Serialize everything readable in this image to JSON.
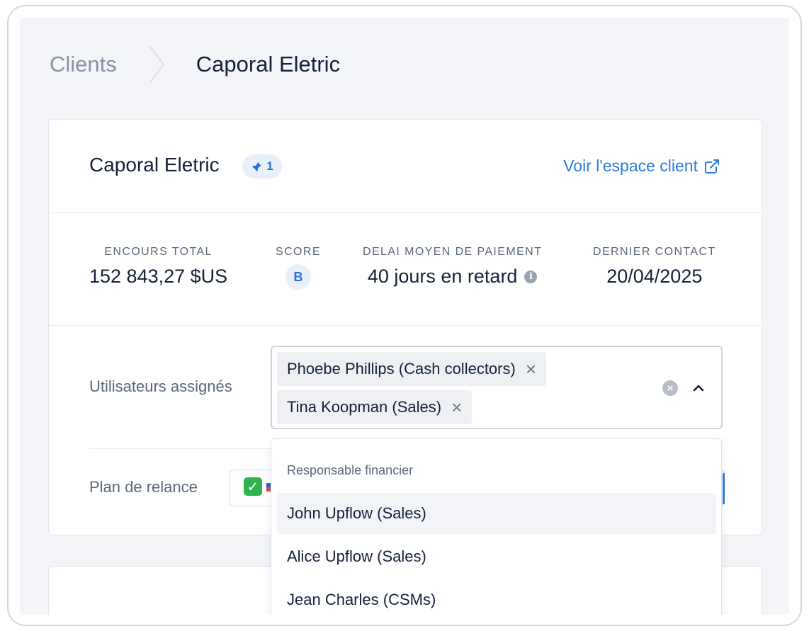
{
  "breadcrumb": {
    "root": "Clients",
    "current": "Caporal Eletric"
  },
  "client": {
    "name": "Caporal Eletric",
    "pin_count": "1",
    "portal_link": "Voir l'espace client"
  },
  "stats": {
    "outstanding": {
      "label": "ENCOURS TOTAL",
      "value": "152 843,27 $US"
    },
    "score": {
      "label": "SCORE",
      "value": "B"
    },
    "avg_delay": {
      "label": "DELAI MOYEN DE PAIEMENT",
      "value": "40 jours en retard"
    },
    "last_contact": {
      "label": "DERNIER CONTACT",
      "value": "20/04/2025"
    }
  },
  "assigned_users": {
    "label": "Utilisateurs assignés",
    "selected": [
      "Phoebe Phillips (Cash collectors)",
      "Tina Koopman (Sales)"
    ]
  },
  "dunning_plan": {
    "label": "Plan de relance"
  },
  "dropdown": {
    "group_label": "Responsable financier",
    "options": [
      "John Upflow (Sales)",
      "Alice Upflow (Sales)",
      "Jean Charles (CSMs)"
    ]
  },
  "colors": {
    "accent": "#2b7de0",
    "badge_bg": "#e8f0fb",
    "page_bg": "#f3f5f9"
  }
}
